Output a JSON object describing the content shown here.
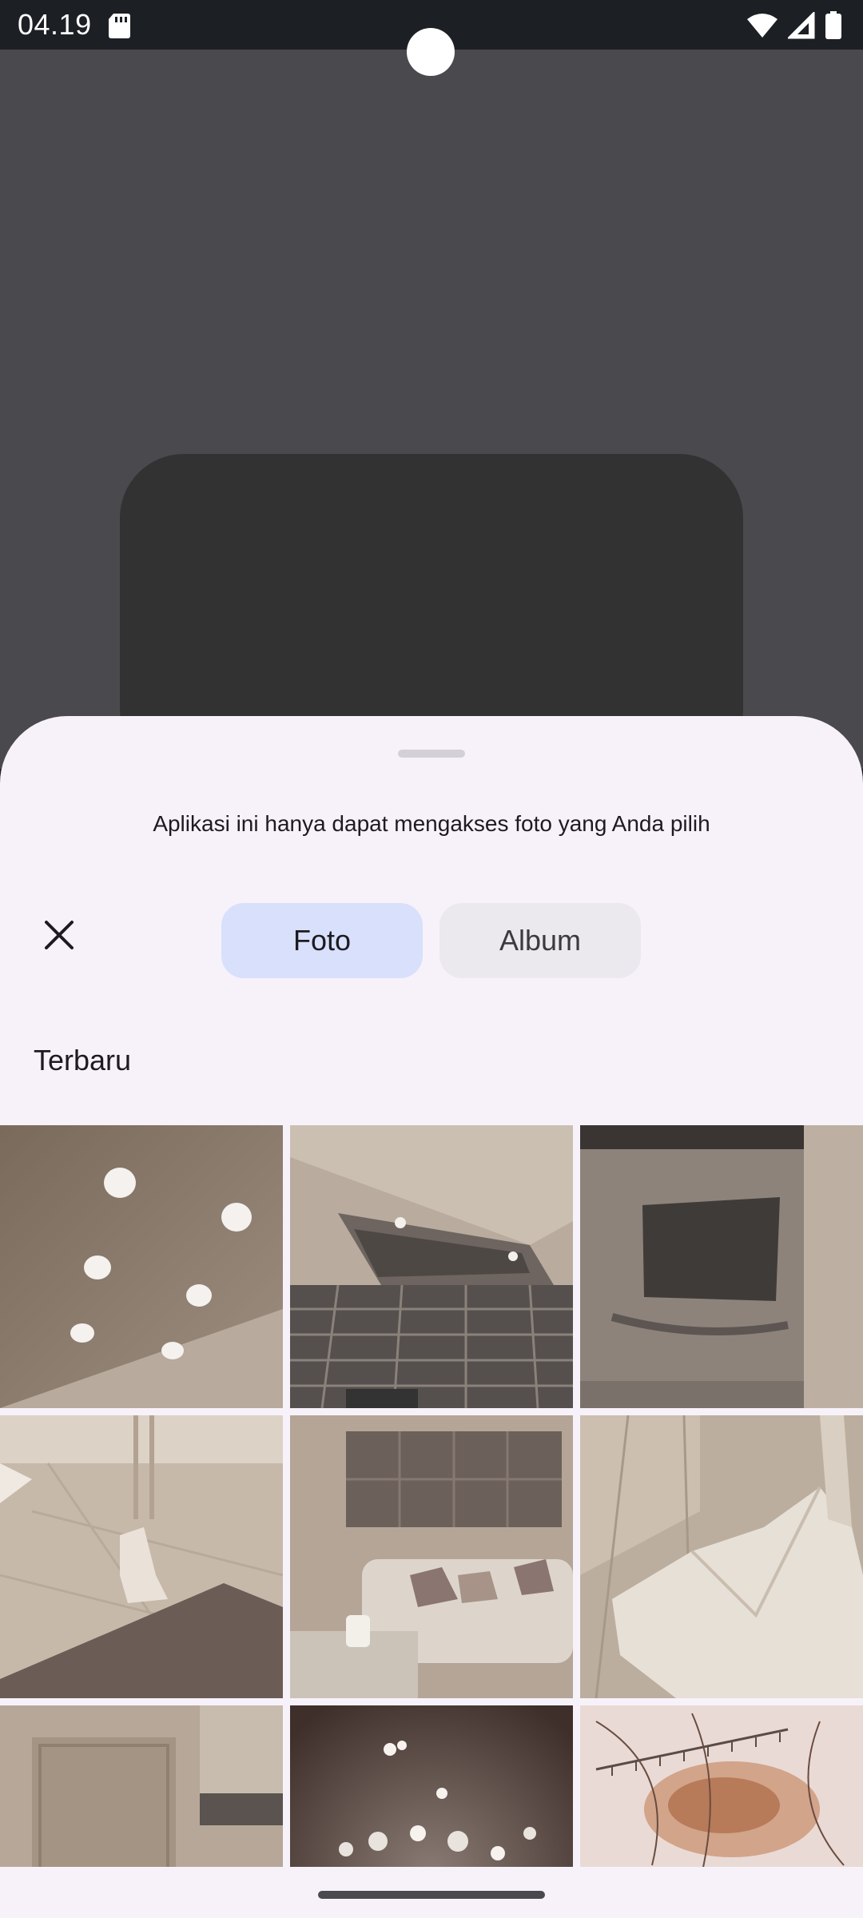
{
  "status_bar": {
    "time": "04.19"
  },
  "icons": {
    "sd_card": "sd-card-icon",
    "wifi": "wifi-icon",
    "signal": "signal-icon",
    "battery": "battery-icon",
    "close": "close-icon"
  },
  "picker": {
    "message": "Aplikasi ini hanya dapat mengakses foto yang Anda pilih",
    "tabs": [
      {
        "label": "Foto",
        "selected": true
      },
      {
        "label": "Album",
        "selected": false
      }
    ],
    "section_title": "Terbaru"
  },
  "colors": {
    "sheet_bg": "#f7f2fa",
    "selected_tab": "#d8e0fb",
    "unselected_tab": "#ebe8ee",
    "backdrop": "#4a494d"
  }
}
